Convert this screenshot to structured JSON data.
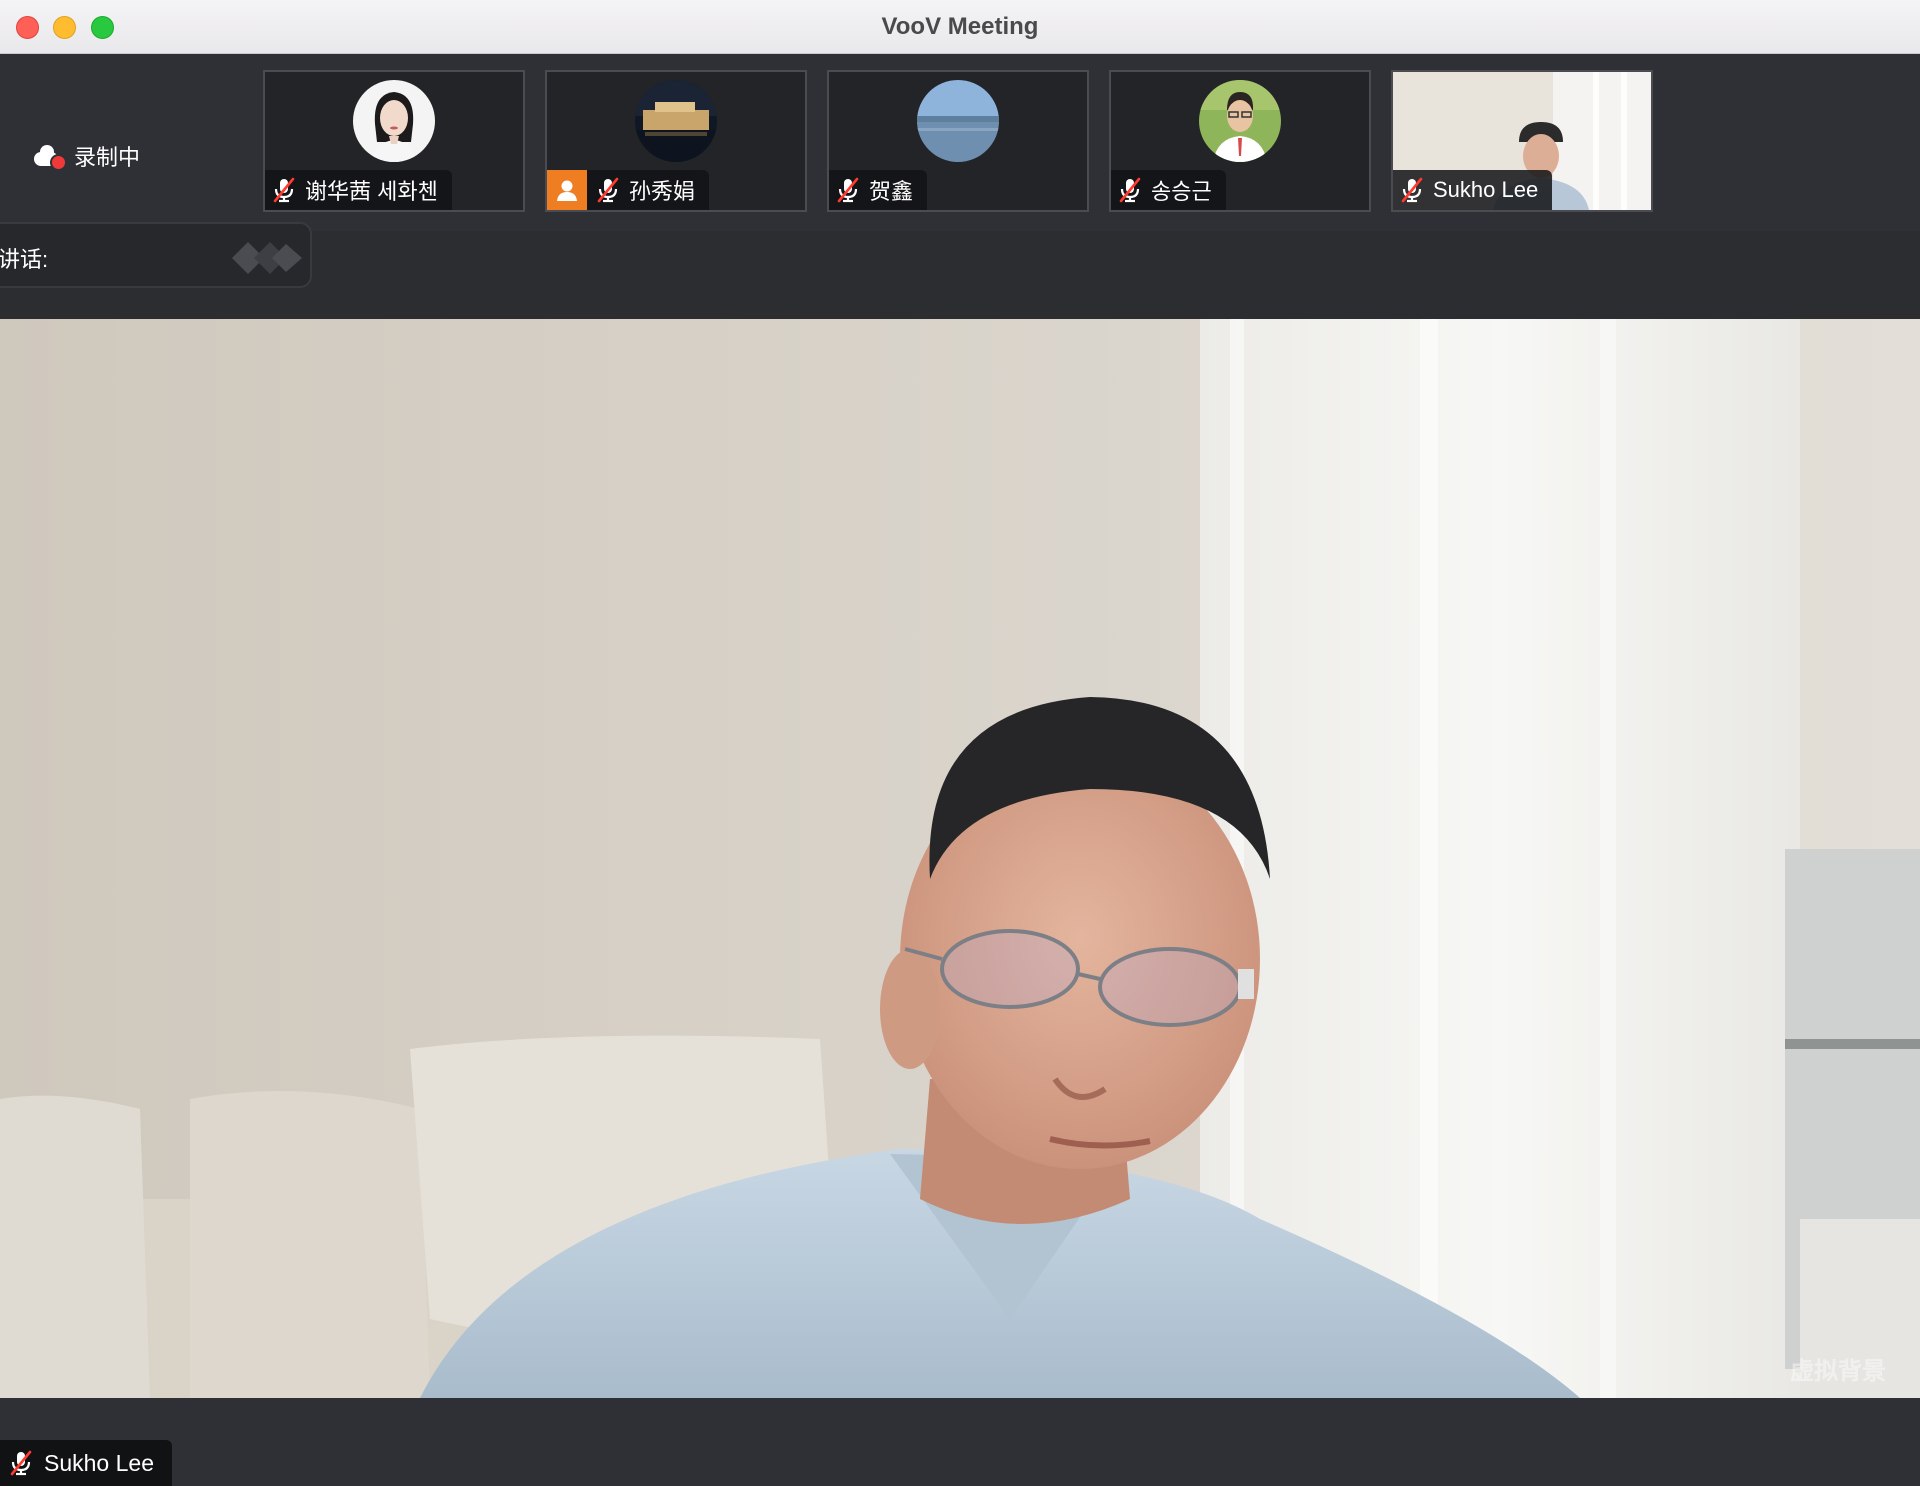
{
  "window": {
    "title": "VooV Meeting"
  },
  "recording": {
    "label": "录制中"
  },
  "speaking": {
    "label": "讲话:"
  },
  "participants": [
    {
      "name": "谢华茜 세화첸",
      "mic": "muted"
    },
    {
      "name": "孙秀娟",
      "mic": "muted"
    },
    {
      "name": "贺鑫",
      "mic": "muted"
    },
    {
      "name": "송승근",
      "mic": "muted"
    },
    {
      "name": "Sukho Lee",
      "mic": "muted"
    }
  ],
  "main_video": {
    "name": "Sukho Lee",
    "watermark": "虚拟背景"
  },
  "icons": [
    "cloud-record-icon",
    "mic-muted-icon",
    "user-icon"
  ],
  "colors": {
    "recording_dot": "#f03a3a",
    "mute_slash": "#ff3b30",
    "user_badge": "#ef7d22",
    "bar_bg": "#2e3035"
  }
}
